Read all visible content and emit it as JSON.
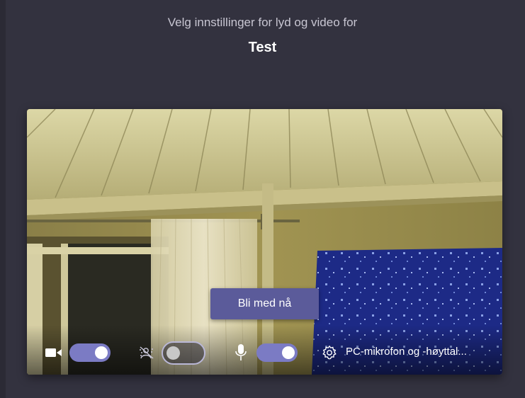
{
  "prejoin": {
    "subtitle": "Velg innstillinger for lyd og video for",
    "meeting_title": "Test"
  },
  "preview": {
    "join_button_label": "Bli med nå",
    "camera_toggle_on": true,
    "background_blur_on": false,
    "mic_toggle_on": true,
    "device_settings_label": "PC-mikrofon og -høyttal..."
  },
  "colors": {
    "background": "#33323f",
    "accent": "#7b7bc4",
    "join_button": "#5b5b9a"
  },
  "icons": {
    "camera": "video-camera-icon",
    "blur": "background-blur-icon",
    "mic": "microphone-icon",
    "settings": "gear-icon"
  }
}
